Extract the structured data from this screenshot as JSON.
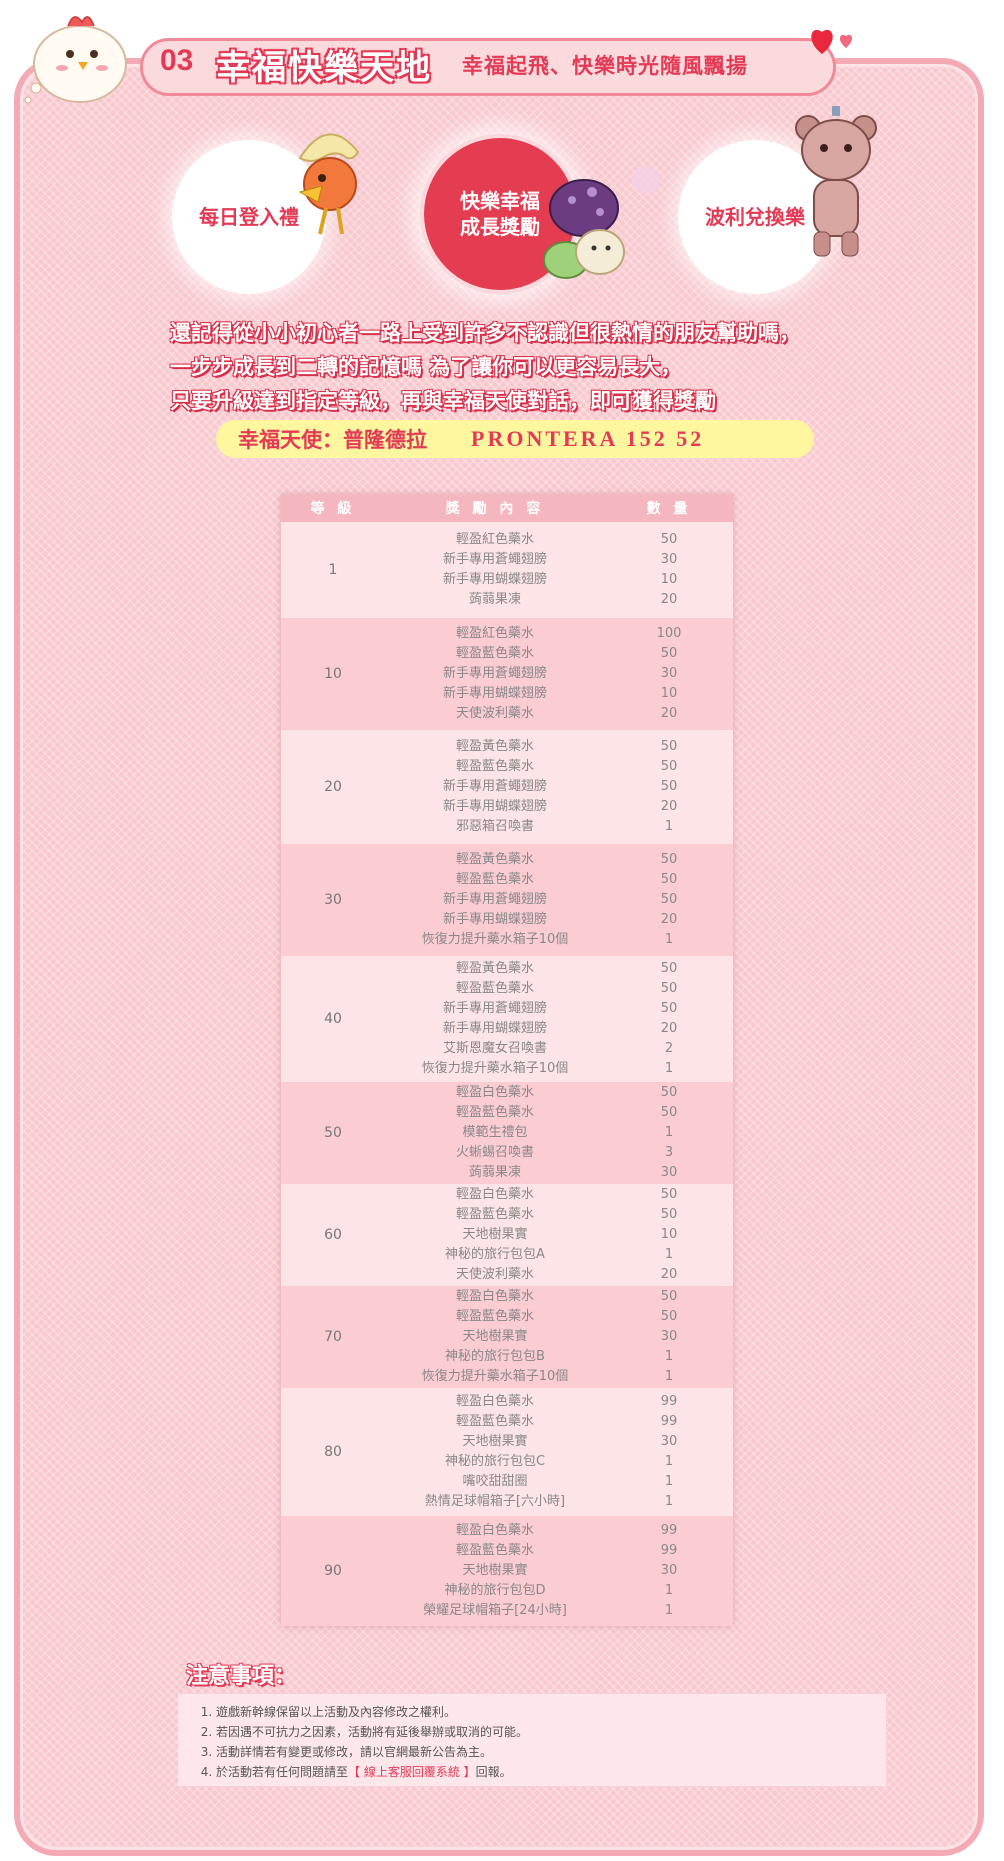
{
  "header": {
    "number": "03",
    "title": "幸福快樂天地",
    "subtitle": "幸福起飛、快樂時光隨風飄揚"
  },
  "circles": [
    {
      "label": "每日登入禮"
    },
    {
      "label": "快樂幸福成長獎勵",
      "line1": "快樂幸福",
      "line2": "成長獎勵",
      "active": true
    },
    {
      "label": "波利兌換樂"
    }
  ],
  "description": [
    "還記得從小小初心者一路上受到許多不認識但很熱情的朋友幫助嗎，",
    "一步步成長到二轉的記憶嗎  為了讓你可以更容易長大，",
    "只要升級達到指定等級，再與幸福天使對話，即可獲得獎勵"
  ],
  "angel": {
    "label": "幸福天使：普隆德拉",
    "coords": "PRONTERA 152 52"
  },
  "table": {
    "headers": [
      "等 級",
      "獎 勵 內 容",
      "數 量"
    ],
    "rows": [
      {
        "level": "1",
        "items": [
          "輕盈紅色藥水",
          "新手專用蒼蠅翅膀",
          "新手專用蝴蝶翅膀",
          "蒟蒻果凍"
        ],
        "qty": [
          "50",
          "30",
          "10",
          "20"
        ]
      },
      {
        "level": "10",
        "items": [
          "輕盈紅色藥水",
          "輕盈藍色藥水",
          "新手專用蒼蠅翅膀",
          "新手專用蝴蝶翅膀",
          "天使波利藥水"
        ],
        "qty": [
          "100",
          "50",
          "30",
          "10",
          "20"
        ]
      },
      {
        "level": "20",
        "items": [
          "輕盈黃色藥水",
          "輕盈藍色藥水",
          "新手專用蒼蠅翅膀",
          "新手專用蝴蝶翅膀",
          "邪惡箱召喚書"
        ],
        "qty": [
          "50",
          "50",
          "50",
          "20",
          "1"
        ]
      },
      {
        "level": "30",
        "items": [
          "輕盈黃色藥水",
          "輕盈藍色藥水",
          "新手專用蒼蠅翅膀",
          "新手專用蝴蝶翅膀",
          "恢復力提升藥水箱子10個"
        ],
        "qty": [
          "50",
          "50",
          "50",
          "20",
          "1"
        ]
      },
      {
        "level": "40",
        "items": [
          "輕盈黃色藥水",
          "輕盈藍色藥水",
          "新手專用蒼蠅翅膀",
          "新手專用蝴蝶翅膀",
          "艾斯恩魔女召喚書",
          "恢復力提升藥水箱子10個"
        ],
        "qty": [
          "50",
          "50",
          "50",
          "20",
          "2",
          "1"
        ]
      },
      {
        "level": "50",
        "items": [
          "輕盈白色藥水",
          "輕盈藍色藥水",
          "模範生禮包",
          "火蜥蜴召喚書",
          "蒟蒻果凍"
        ],
        "qty": [
          "50",
          "50",
          "1",
          "3",
          "30"
        ]
      },
      {
        "level": "60",
        "items": [
          "輕盈白色藥水",
          "輕盈藍色藥水",
          "天地樹果實",
          "神秘的旅行包包A",
          "天使波利藥水"
        ],
        "qty": [
          "50",
          "50",
          "10",
          "1",
          "20"
        ]
      },
      {
        "level": "70",
        "items": [
          "輕盈白色藥水",
          "輕盈藍色藥水",
          "天地樹果實",
          "神秘的旅行包包B",
          "恢復力提升藥水箱子10個"
        ],
        "qty": [
          "50",
          "50",
          "30",
          "1",
          "1"
        ]
      },
      {
        "level": "80",
        "items": [
          "輕盈白色藥水",
          "輕盈藍色藥水",
          "天地樹果實",
          "神秘的旅行包包C",
          "嘴咬甜甜圈",
          "熱情足球帽箱子[六小時]"
        ],
        "qty": [
          "99",
          "99",
          "30",
          "1",
          "1",
          "1"
        ]
      },
      {
        "level": "90",
        "items": [
          "輕盈白色藥水",
          "輕盈藍色藥水",
          "天地樹果實",
          "神秘的旅行包包D",
          "榮耀足球帽箱子[24小時]"
        ],
        "qty": [
          "99",
          "99",
          "30",
          "1",
          "1"
        ]
      }
    ]
  },
  "notes": {
    "title": "注意事項：",
    "items": [
      "遊戲新幹線保留以上活動及內容修改之權利。",
      "若因遇不可抗力之因素，活動將有延後舉辦或取消的可能。",
      "活動詳情若有變更或修改，請以官網最新公告為主。"
    ],
    "item4_prefix": "於活動若有任何問題請至",
    "item4_link": "【 線上客服回覆系統 】",
    "item4_suffix": "回報。"
  },
  "colors": {
    "accent": "#e33a55",
    "panel": "#f8c8ce",
    "pill": "#fff6a0"
  }
}
